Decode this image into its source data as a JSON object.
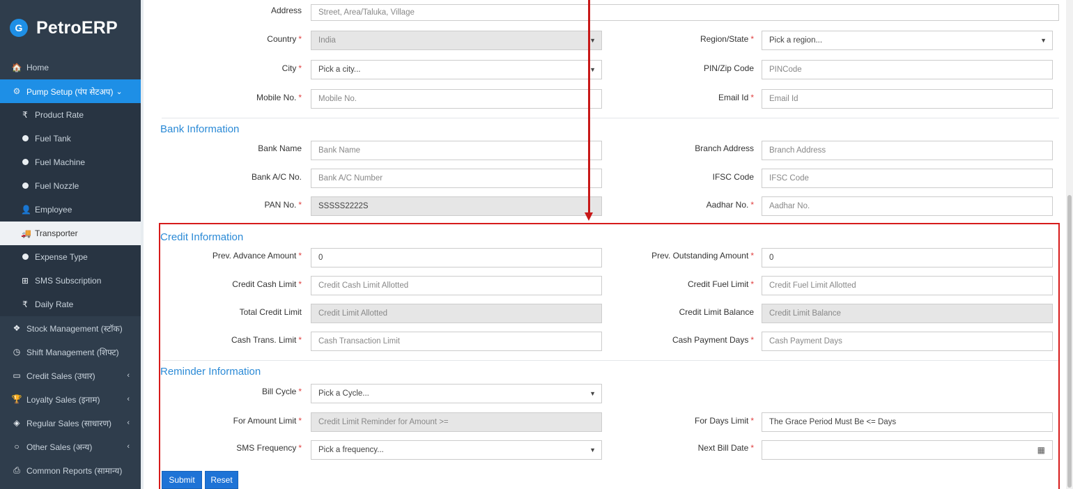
{
  "brand": {
    "name": "PetroERP",
    "logo_glyph": "G"
  },
  "sidebar": {
    "items": [
      {
        "label": "Home",
        "icon": "home-icon",
        "glyph": "🏠"
      },
      {
        "label": "Pump Setup (पंप सेटअप)",
        "icon": "gears-icon",
        "glyph": "⚙",
        "chevron": "⌄"
      },
      {
        "label": "Product Rate",
        "icon": "rupee-icon",
        "glyph": "₹"
      },
      {
        "label": "Fuel Tank",
        "icon": "dot-icon"
      },
      {
        "label": "Fuel Machine",
        "icon": "dot-icon"
      },
      {
        "label": "Fuel Nozzle",
        "icon": "dot-icon"
      },
      {
        "label": "Employee",
        "icon": "user-icon",
        "glyph": "👤"
      },
      {
        "label": "Transporter",
        "icon": "truck-icon",
        "glyph": "🚚"
      },
      {
        "label": "Expense Type",
        "icon": "dot-icon"
      },
      {
        "label": "SMS Subscription",
        "icon": "plus-square-icon",
        "glyph": "⊞"
      },
      {
        "label": "Daily Rate",
        "icon": "rupee-icon",
        "glyph": "₹"
      },
      {
        "label": "Stock Management (स्टॉक)",
        "icon": "cubes-icon",
        "glyph": "❖"
      },
      {
        "label": "Shift Management (शिफ्ट)",
        "icon": "clock-icon",
        "glyph": "◷"
      },
      {
        "label": "Credit Sales (उधार)",
        "icon": "credit-card-icon",
        "glyph": "▭",
        "chevron": "‹"
      },
      {
        "label": "Loyalty Sales (इनाम)",
        "icon": "trophy-icon",
        "glyph": "🏆",
        "chevron": "‹"
      },
      {
        "label": "Regular Sales (साधारण)",
        "icon": "cube-icon",
        "glyph": "◈",
        "chevron": "‹"
      },
      {
        "label": "Other Sales (अन्य)",
        "icon": "circle-icon",
        "glyph": "○",
        "chevron": "‹"
      },
      {
        "label": "Common Reports (सामान्य)",
        "icon": "print-icon",
        "glyph": "⎙"
      }
    ]
  },
  "form": {
    "address": {
      "label": "Address",
      "placeholder": "Street, Area/Taluka, Village"
    },
    "country": {
      "label": "Country",
      "value": "India"
    },
    "region": {
      "label": "Region/State",
      "value": "Pick a region..."
    },
    "city": {
      "label": "City",
      "value": "Pick a city..."
    },
    "pin": {
      "label": "PIN/Zip Code",
      "placeholder": "PINCode"
    },
    "mobile": {
      "label": "Mobile No.",
      "placeholder": "Mobile No."
    },
    "email": {
      "label": "Email Id",
      "placeholder": "Email Id"
    },
    "bank_section": "Bank Information",
    "bank_name": {
      "label": "Bank Name",
      "placeholder": "Bank Name"
    },
    "branch_address": {
      "label": "Branch Address",
      "placeholder": "Branch Address"
    },
    "bank_ac": {
      "label": "Bank A/C No.",
      "placeholder": "Bank A/C Number"
    },
    "ifsc": {
      "label": "IFSC Code",
      "placeholder": "IFSC Code"
    },
    "pan": {
      "label": "PAN No.",
      "value": "SSSSS2222S"
    },
    "aadhar": {
      "label": "Aadhar No.",
      "placeholder": "Aadhar No."
    },
    "credit_section": "Credit Information",
    "prev_advance": {
      "label": "Prev. Advance Amount",
      "value": "0"
    },
    "prev_outstanding": {
      "label": "Prev. Outstanding Amount",
      "value": "0"
    },
    "credit_cash_limit": {
      "label": "Credit Cash Limit",
      "placeholder": "Credit Cash Limit Allotted"
    },
    "credit_fuel_limit": {
      "label": "Credit Fuel Limit",
      "placeholder": "Credit Fuel Limit Allotted"
    },
    "total_credit_limit": {
      "label": "Total Credit Limit",
      "placeholder": "Credit Limit Allotted"
    },
    "credit_limit_balance": {
      "label": "Credit Limit Balance",
      "placeholder": "Credit Limit Balance"
    },
    "cash_trans_limit": {
      "label": "Cash Trans. Limit",
      "placeholder": "Cash Transaction Limit"
    },
    "cash_payment_days": {
      "label": "Cash Payment Days",
      "placeholder": "Cash Payment Days"
    },
    "reminder_section": "Reminder Information",
    "bill_cycle": {
      "label": "Bill Cycle",
      "value": "Pick a Cycle..."
    },
    "for_amount_limit": {
      "label": "For Amount Limit",
      "placeholder": "Credit Limit Reminder for Amount >="
    },
    "for_days_limit": {
      "label": "For Days Limit",
      "placeholder": "The Grace Period Must Be <= Days"
    },
    "sms_frequency": {
      "label": "SMS Frequency",
      "value": "Pick a frequency..."
    },
    "next_bill_date": {
      "label": "Next Bill Date",
      "value": ""
    },
    "required_mark": "*",
    "submit_label": "Submit",
    "reset_label": "Reset"
  },
  "colors": {
    "sidebar_bg": "#2f3d4c",
    "accent": "#1e8fe6",
    "highlight": "#d61b1b",
    "section_title": "#2b8ad6"
  }
}
